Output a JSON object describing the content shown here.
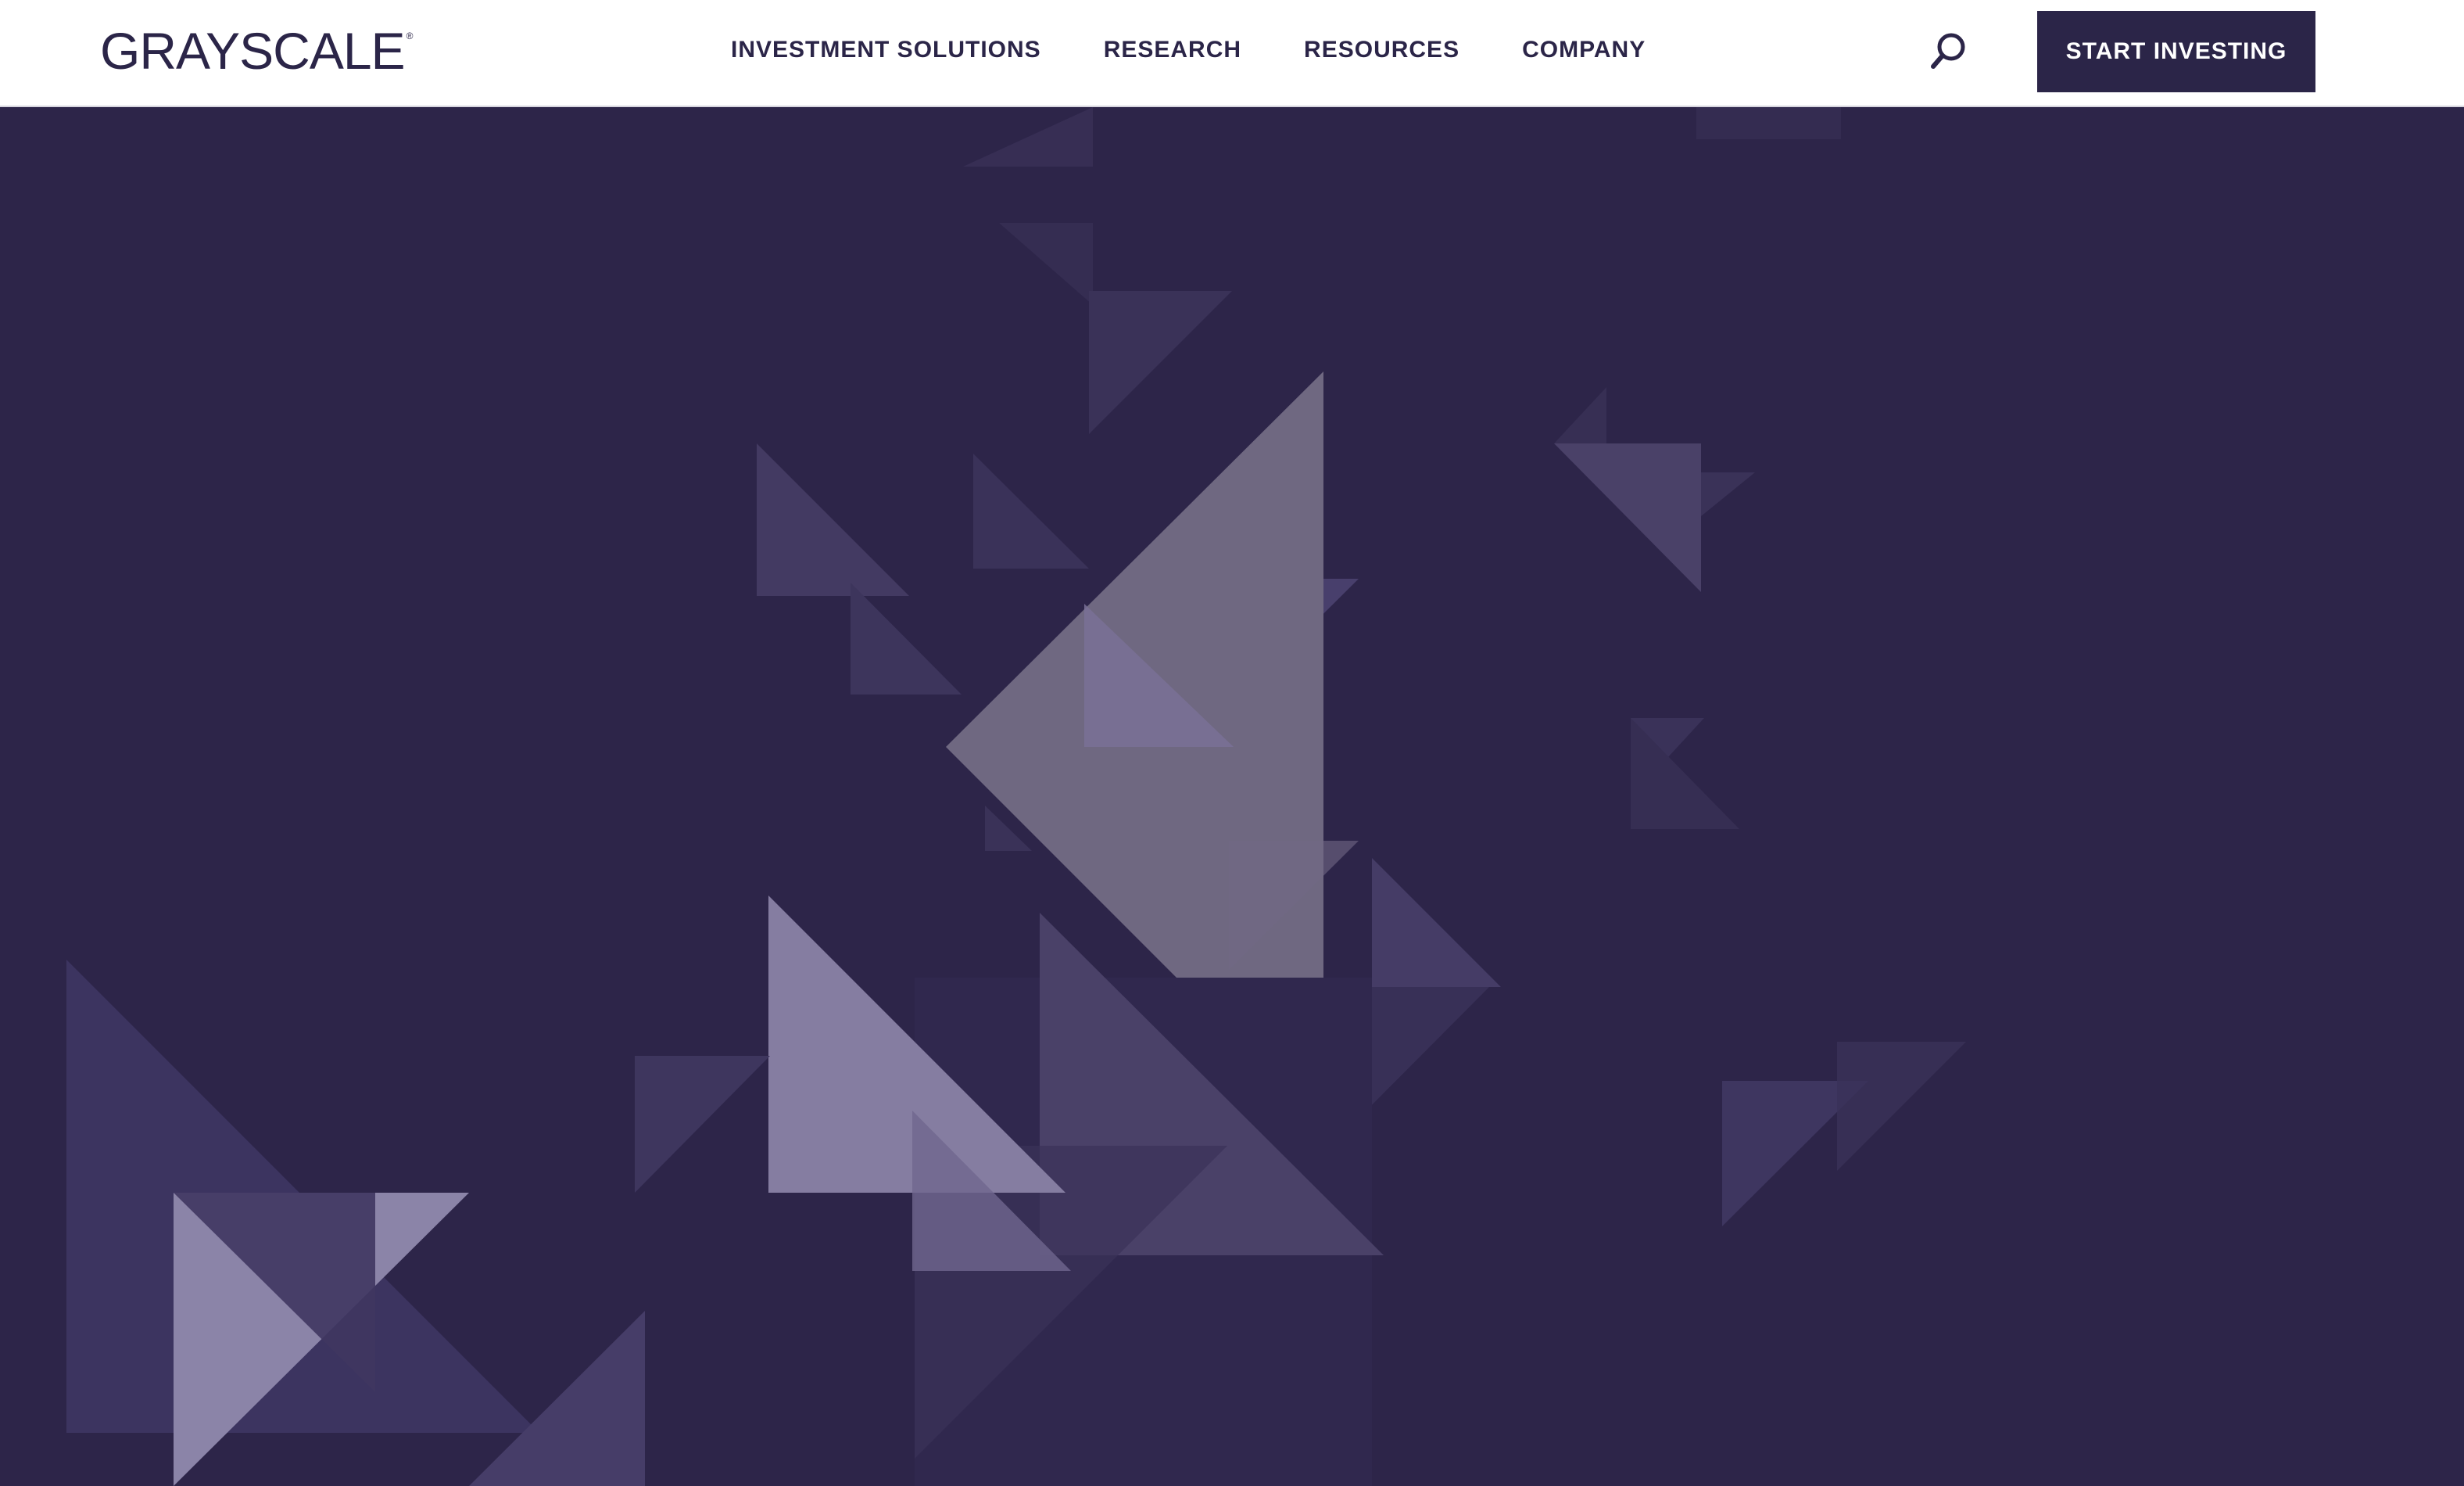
{
  "header": {
    "logo_text": "GRAYSCALE",
    "logo_mark": "®",
    "nav": [
      {
        "label": "INVESTMENT SOLUTIONS"
      },
      {
        "label": "RESEARCH"
      },
      {
        "label": "RESOURCES"
      },
      {
        "label": "COMPANY"
      }
    ],
    "search_icon": "search-icon",
    "cta_label": "START INVESTING"
  },
  "colors": {
    "brand": "#2b2548",
    "hero_bg": "#2d2549",
    "header_bg": "#ffffff"
  }
}
